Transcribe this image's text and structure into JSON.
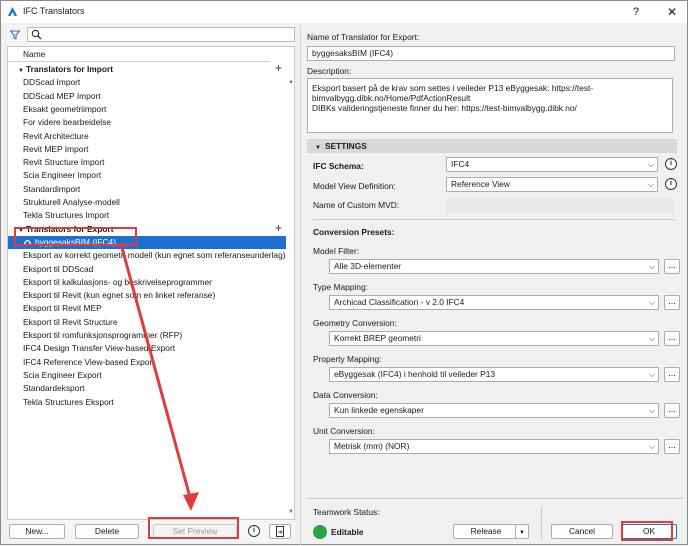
{
  "window": {
    "title": "IFC Translators",
    "help": "?",
    "close": "✕"
  },
  "left": {
    "column_header": "Name",
    "import_group": "Translators for Import",
    "import_items": [
      "DDScad Import",
      "DDScad MEP Import",
      "Eksakt geometriimport",
      "For videre bearbeidelse",
      "Revit Architecture",
      "Revit MEP Import",
      "Revit Structure Import",
      "Scia Engineer Import",
      "Standardimport",
      "Strukturell Analyse-modell",
      "Tekla Structures Import"
    ],
    "export_group": "Translators for Export",
    "export_items": [
      "byggesaksBIM (IFC4)",
      "Eksport av korrekt geometri modell (kun egnet som referanseunderlag)",
      "Eksport til DDScad",
      "Eksport til kalkulasjons- og beskrivelseprogrammer",
      "Eksport til Revit (kun egnet som en linket referanse)",
      "Eksport til Revit MEP",
      "Eksport til Revit Structure",
      "Eksport til romfunksjonsprogrammer (RFP)",
      "IFC4 Design Transfer View-based Export",
      "IFC4 Reference View-based Export",
      "Scia Engineer Export",
      "Standardeksport",
      "Tekla Structures Eksport"
    ],
    "buttons": {
      "new": "New...",
      "delete": "Delete",
      "set_preview": "Set Preview"
    }
  },
  "right": {
    "name_label": "Name of Translator for Export:",
    "name_value": "byggesaksBIM (IFC4)",
    "desc_label": "Description:",
    "desc_value": "Eksport basert på de krav som settes i veileder P13 eByggesak: https://test-\nbimvalbygg.dibk.no/Home/PdfActionResult\nDIBKs valideringstjeneste finner du her: https://test-bimvalbygg.dibk.no/",
    "settings": "SETTINGS",
    "ifc_schema_label": "IFC Schema:",
    "ifc_schema_value": "IFC4",
    "mvd_label": "Model View Definition:",
    "mvd_value": "Reference View",
    "custom_mvd_label": "Name of Custom MVD:",
    "presets_label": "Conversion Presets:",
    "model_filter_label": "Model Filter:",
    "model_filter_value": "Alle 3D-elementer",
    "type_mapping_label": "Type Mapping:",
    "type_mapping_value": "Archicad Classification - v 2.0 IFC4",
    "geometry_label": "Geometry Conversion:",
    "geometry_value": "Korrekt BREP geometri",
    "property_label": "Property Mapping:",
    "property_value": "eByggesak (IFC4) i henhold til veileder P13",
    "data_label": "Data Conversion:",
    "data_value": "Kun linkede egenskaper",
    "unit_label": "Unit Conversion:",
    "unit_value": "Metrisk (mm) (NOR)",
    "teamwork_label": "Teamwork Status:",
    "teamwork_value": "Editable",
    "release": "Release",
    "cancel": "Cancel",
    "ok": "OK",
    "dots": "...",
    "info": "i"
  }
}
